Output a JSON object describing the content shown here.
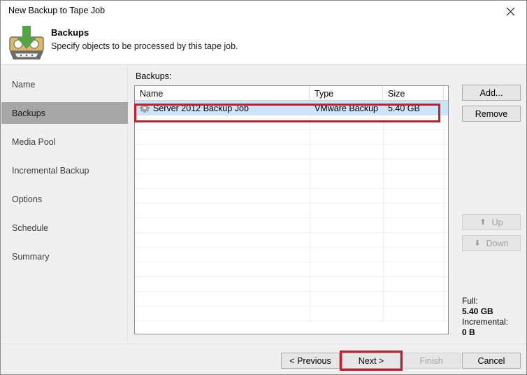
{
  "window": {
    "title": "New Backup to Tape Job",
    "close_icon": "close-icon"
  },
  "header": {
    "icon": "tape-cartridge-download-icon",
    "title": "Backups",
    "subtitle": "Specify objects to be processed by this tape job."
  },
  "sidebar": {
    "items": [
      {
        "label": "Name",
        "selected": false
      },
      {
        "label": "Backups",
        "selected": true
      },
      {
        "label": "Media Pool",
        "selected": false
      },
      {
        "label": "Incremental Backup",
        "selected": false
      },
      {
        "label": "Options",
        "selected": false
      },
      {
        "label": "Schedule",
        "selected": false
      },
      {
        "label": "Summary",
        "selected": false
      }
    ]
  },
  "main": {
    "list_label": "Backups:",
    "columns": [
      "Name",
      "Type",
      "Size"
    ],
    "rows": [
      {
        "icon": "gear-icon",
        "name": "Server 2012 Backup Job",
        "type": "VMware Backup",
        "size": "5.40 GB",
        "selected": true
      }
    ],
    "empty_row_count": 14,
    "side_buttons": [
      {
        "label": "Add...",
        "enabled": true,
        "icon": null
      },
      {
        "label": "Remove",
        "enabled": true,
        "icon": null
      },
      {
        "label": "Up",
        "enabled": false,
        "icon": "arrow-up-icon"
      },
      {
        "label": "Down",
        "enabled": false,
        "icon": "arrow-down-icon"
      }
    ],
    "totals": {
      "full_label": "Full:",
      "full_value": "5.40 GB",
      "incremental_label": "Incremental:",
      "incremental_value": "0 B"
    }
  },
  "footer": {
    "previous_label": "< Previous",
    "next_label": "Next >",
    "finish_label": "Finish",
    "cancel_label": "Cancel",
    "finish_enabled": false
  },
  "annotations": {
    "highlight_color": "#c0202e",
    "selection_color": "#cce4f7",
    "sidebar_selected_color": "#a6a6a6"
  }
}
